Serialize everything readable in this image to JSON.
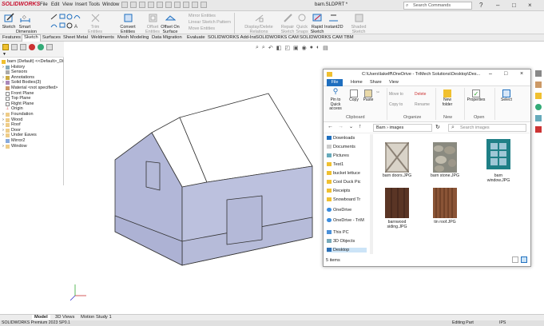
{
  "app": {
    "logo": "SOLIDWORKS",
    "menus": [
      "File",
      "Edit",
      "View",
      "Insert",
      "Tools",
      "Window"
    ],
    "doc_title": "barn.SLDPRT *",
    "search_placeholder": "Search Commands"
  },
  "ribbon": {
    "sketch": "Sketch",
    "smart_dimension": "Smart Dimension",
    "trim_entities": "Trim Entities",
    "convert_entities": "Convert Entities",
    "offset_entities": "Offset Entities",
    "offset_on_surface": "Offset On Surface",
    "mirror_entities": "Mirror Entities",
    "linear_sketch_pattern": "Linear Sketch Pattern",
    "move_entities": "Move Entities",
    "display_delete_relations": "Display/Delete Relations",
    "repair_sketch": "Repair Sketch",
    "quick_snaps": "Quick Snaps",
    "rapid_sketch": "Rapid Sketch",
    "instant2d": "Instant2D",
    "shaded_sketch_contours": "Shaded Sketch Contours"
  },
  "tabs": [
    "Features",
    "Sketch",
    "Surfaces",
    "Sheet Metal",
    "Weldments",
    "Mesh Modeling",
    "Data Migration",
    "Evaluate",
    "SOLIDWORKS Add-Ins",
    "SOLIDWORKS CAM",
    "SOLIDWORKS CAM TBM"
  ],
  "active_tab": "Sketch",
  "tree": {
    "root": "barn (Default) <<Default>_Di",
    "items": [
      "History",
      "Sensors",
      "Annotations",
      "Solid Bodies(3)",
      "Material <not specified>",
      "Front Plane",
      "Top Plane",
      "Right Plane",
      "Origin",
      "Foundation",
      "Wood",
      "Roof",
      "Door",
      "Under Eaves",
      "Mirror2",
      "Window"
    ]
  },
  "bottom": {
    "tabs": [
      "Model",
      "3D Views",
      "Motion Study 1"
    ],
    "status_left": "SOLIDWORKS Premium 2023 SP0.1",
    "status_mid": "Editing Part",
    "status_right": "IPS"
  },
  "explorer": {
    "path": "C:\\Users\\lakelff\\OneDrive - TriMech Solutions\\Desktop\\Des...",
    "ribbon_tabs": [
      "File",
      "Home",
      "Share",
      "View"
    ],
    "clipboard": {
      "pin": "Pin to Quick access",
      "copy": "Copy",
      "paste": "Paste",
      "group": "Clipboard"
    },
    "organize": {
      "move_to": "Move to",
      "copy_to": "Copy to",
      "delete": "Delete",
      "rename": "Rename",
      "group": "Organize"
    },
    "new": {
      "new_folder": "New folder",
      "group": "New"
    },
    "open": {
      "properties": "Properties",
      "group": "Open"
    },
    "select": {
      "select": "Select"
    },
    "address": "Barn › images",
    "search_placeholder": "Search images",
    "nav": [
      "Downloads",
      "Documents",
      "Pictures",
      "Test1",
      "bucket lettuce",
      "Cool Duck Pic",
      "Receipts",
      "Snowboard Tr",
      "OneDrive",
      "OneDrive - TriM",
      "This PC",
      "3D Objects",
      "Desktop"
    ],
    "files": [
      "barn doors.JPG",
      "barn stone.JPG",
      "barn window.JPG",
      "barnwood siding.JPG",
      "tin roof.JPG"
    ],
    "status": "5 items"
  },
  "colors": {
    "wall": "#b9bedc",
    "roof": "#ffffff",
    "accent": "#1f6fbf"
  }
}
